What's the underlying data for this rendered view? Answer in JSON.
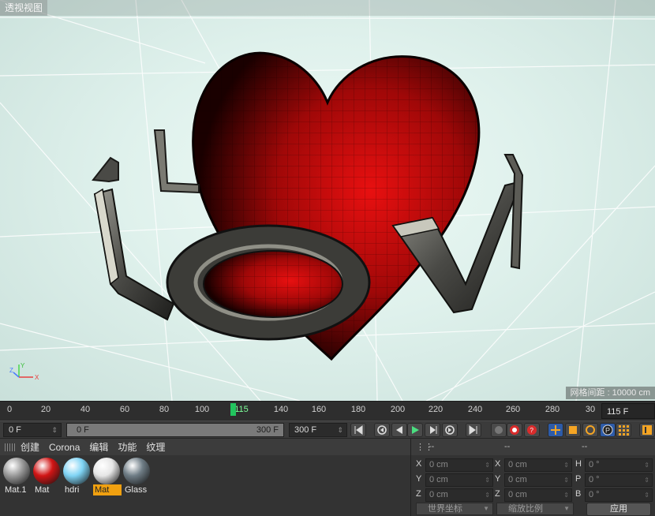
{
  "viewport": {
    "title": "透视视图",
    "grid_spacing": "网格间距 : 10000 cm",
    "axis_labels": {
      "y": "Y",
      "z": "Z",
      "x": "X"
    }
  },
  "timeline": {
    "ticks": [
      "0",
      "20",
      "40",
      "60",
      "80",
      "100",
      "115",
      "140",
      "160",
      "180",
      "200",
      "220",
      "240",
      "260",
      "280",
      "30"
    ],
    "current_frame": "115 F",
    "playhead_frame": 115
  },
  "transport": {
    "start_field": "0 F",
    "range_start": "0 F",
    "range_end": "300 F",
    "end_field": "300 F",
    "buttons": [
      "go-to-start",
      "prev-key",
      "play-back",
      "play",
      "next-frame",
      "next-key",
      "go-to-end",
      "record",
      "auto-key",
      "keyframe-selection",
      "move",
      "scale",
      "rotate",
      "param",
      "point-level",
      "timeline-toggle"
    ]
  },
  "materials": {
    "menu": [
      "创建",
      "Corona",
      "编辑",
      "功能",
      "纹理"
    ],
    "items": [
      {
        "label": "Mat.1",
        "color": "#9a9a9a",
        "selected": false
      },
      {
        "label": "Mat",
        "color": "#d11515",
        "selected": false
      },
      {
        "label": "hdri",
        "color": "#7fd4f5",
        "selected": false
      },
      {
        "label": "Mat",
        "color": "#e6e6e6",
        "selected": true
      },
      {
        "label": "Glass",
        "color": "#6f7d86",
        "selected": false
      }
    ]
  },
  "coordinates": {
    "headers": [
      "--",
      "--",
      "--"
    ],
    "rows": [
      {
        "a_label": "X",
        "a_value": "0 cm",
        "b_label": "X",
        "b_value": "0 cm",
        "c_label": "H",
        "c_value": "0 °"
      },
      {
        "a_label": "Y",
        "a_value": "0 cm",
        "b_label": "Y",
        "b_value": "0 cm",
        "c_label": "P",
        "c_value": "0 °"
      },
      {
        "a_label": "Z",
        "a_value": "0 cm",
        "b_label": "Z",
        "b_value": "0 cm",
        "c_label": "B",
        "c_value": "0 °"
      }
    ],
    "world_coords": "世界坐标",
    "scale_ratio": "缩放比例",
    "apply": "应用"
  }
}
